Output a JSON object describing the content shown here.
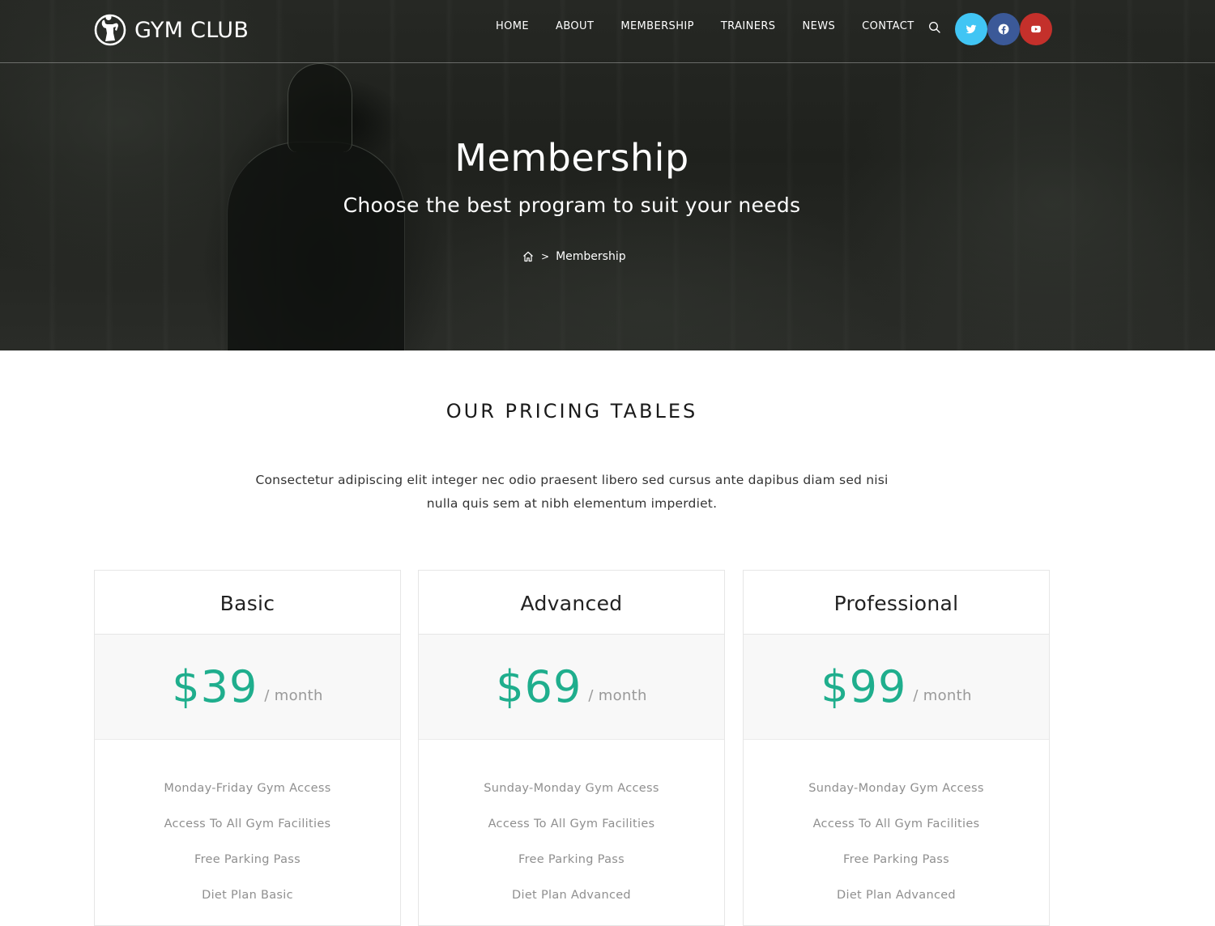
{
  "site": {
    "logo_text": "GYM CLUB",
    "logo_icon": "bodybuilder-icon"
  },
  "nav": {
    "items": [
      {
        "label": "HOME"
      },
      {
        "label": "ABOUT"
      },
      {
        "label": "MEMBERSHIP"
      },
      {
        "label": "TRAINERS"
      },
      {
        "label": "NEWS"
      },
      {
        "label": "CONTACT"
      }
    ],
    "search_icon": "search-icon",
    "social": [
      {
        "name": "twitter",
        "icon": "twitter-icon",
        "color": "#41c5f4"
      },
      {
        "name": "facebook",
        "icon": "facebook-icon",
        "color": "#3b5998"
      },
      {
        "name": "youtube",
        "icon": "youtube-icon",
        "color": "#c4302b"
      }
    ]
  },
  "hero": {
    "title": "Membership",
    "subtitle": "Choose the best program to suit your needs",
    "breadcrumb": {
      "home_icon": "home-icon",
      "separator": ">",
      "current": "Membership"
    }
  },
  "pricing": {
    "title": "OUR PRICING TABLES",
    "description": "Consectetur adipiscing elit integer nec odio praesent libero sed cursus ante dapibus diam sed nisi nulla quis sem at nibh elementum imperdiet.",
    "accent_color": "#1fae8d",
    "plans": [
      {
        "name": "Basic",
        "price": "$39",
        "period": "/ month",
        "features": [
          "Monday-Friday Gym Access",
          "Access To All Gym Facilities",
          "Free Parking Pass",
          "Diet Plan Basic"
        ]
      },
      {
        "name": "Advanced",
        "price": "$69",
        "period": "/ month",
        "features": [
          "Sunday-Monday Gym Access",
          "Access To All Gym Facilities",
          "Free Parking Pass",
          "Diet Plan Advanced"
        ]
      },
      {
        "name": "Professional",
        "price": "$99",
        "period": "/ month",
        "features": [
          "Sunday-Monday Gym Access",
          "Access To All Gym Facilities",
          "Free Parking Pass",
          "Diet Plan Advanced"
        ]
      }
    ]
  }
}
